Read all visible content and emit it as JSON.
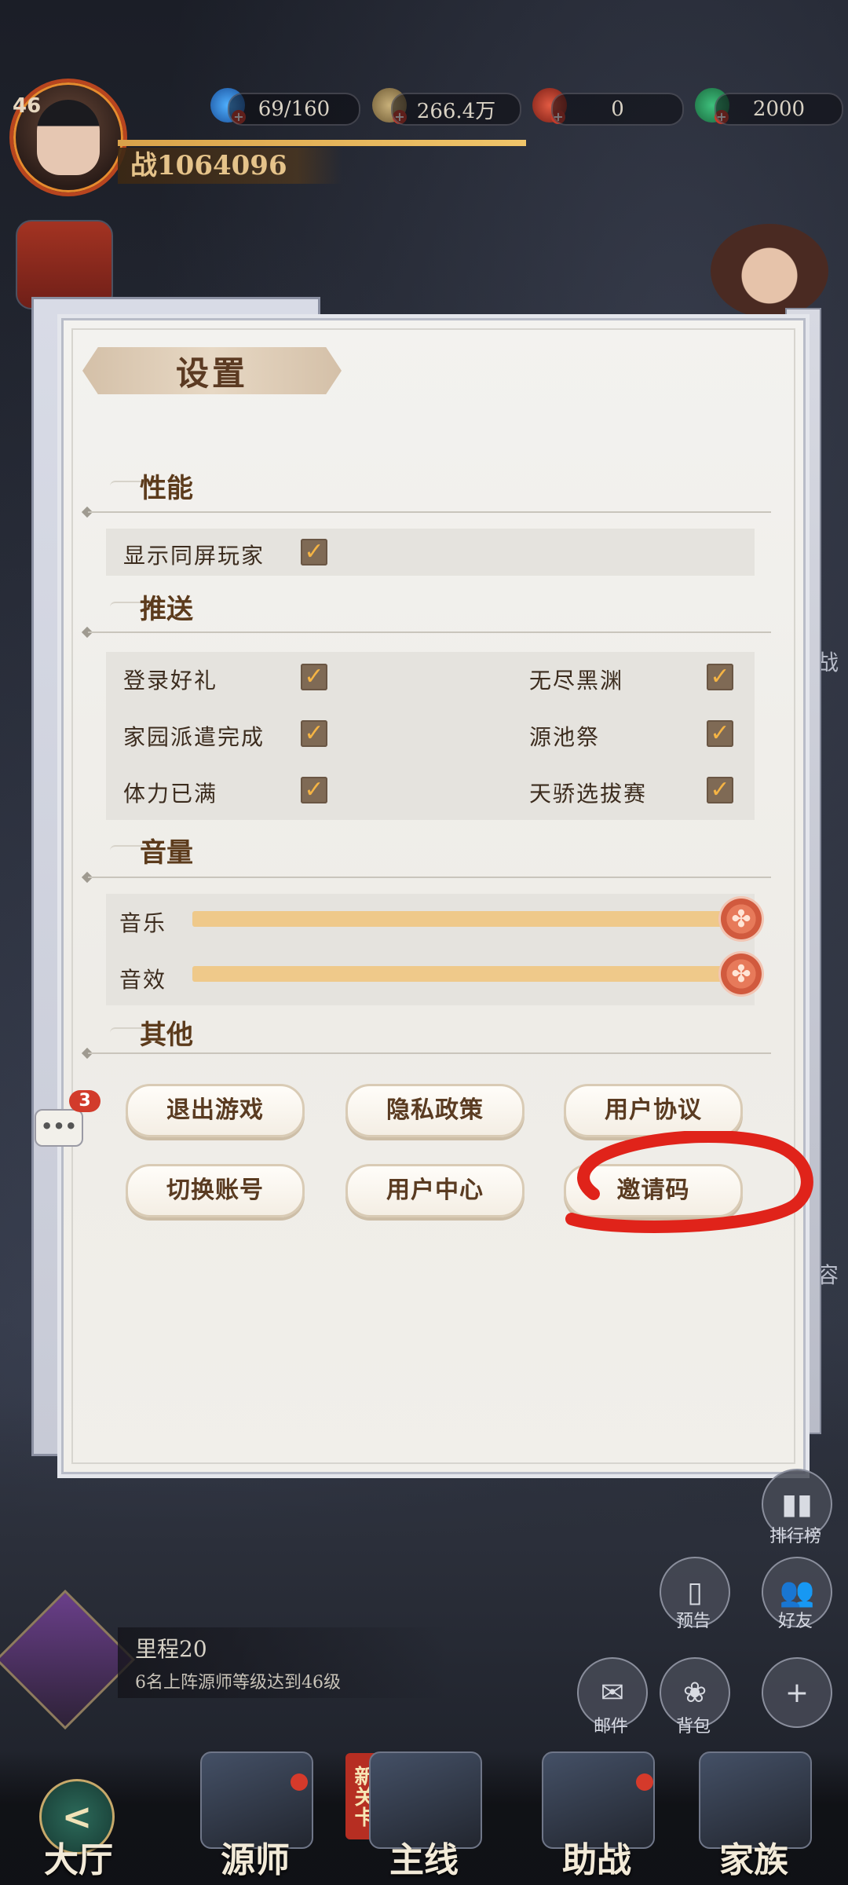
{
  "hud": {
    "level": "46",
    "stamina": "69/160",
    "coins": "266.4万",
    "red_currency": "0",
    "green_currency": "2000",
    "power": "战1064096"
  },
  "settings": {
    "title": "设置",
    "sections": {
      "performance": {
        "title": "性能",
        "show_players_label": "显示同屏玩家",
        "show_players_checked": true
      },
      "push": {
        "title": "推送",
        "items": [
          {
            "label": "登录好礼",
            "checked": true
          },
          {
            "label": "无尽黑渊",
            "checked": true
          },
          {
            "label": "家园派遣完成",
            "checked": true
          },
          {
            "label": "源池祭",
            "checked": true
          },
          {
            "label": "体力已满",
            "checked": true
          },
          {
            "label": "天骄选拔赛",
            "checked": true
          }
        ]
      },
      "volume": {
        "title": "音量",
        "music_label": "音乐",
        "music_level": 1.0,
        "sfx_label": "音效",
        "sfx_level": 1.0
      },
      "other": {
        "title": "其他",
        "buttons": [
          "退出游戏",
          "隐私政策",
          "用户协议",
          "切换账号",
          "用户中心",
          "邀请码"
        ]
      }
    }
  },
  "chat": {
    "badge": "3",
    "icon": "•••"
  },
  "side": {
    "rank_label": "排行榜",
    "preview_label": "预告",
    "friends_label": "好友",
    "mail_label": "邮件",
    "bag_label": "背包",
    "right_text_1": "战",
    "right_text_2": "容"
  },
  "milestone": {
    "title": "里程20",
    "desc": "6名上阵源师等级达到46级"
  },
  "nav": {
    "hall": "大厅",
    "masters": "源师",
    "main": "主线",
    "assist": "助战",
    "family": "家族",
    "new_tag": "新关卡"
  },
  "colors": {
    "annotation": "#e0231a",
    "check": "#f5b444",
    "slider": "#efc98a"
  }
}
